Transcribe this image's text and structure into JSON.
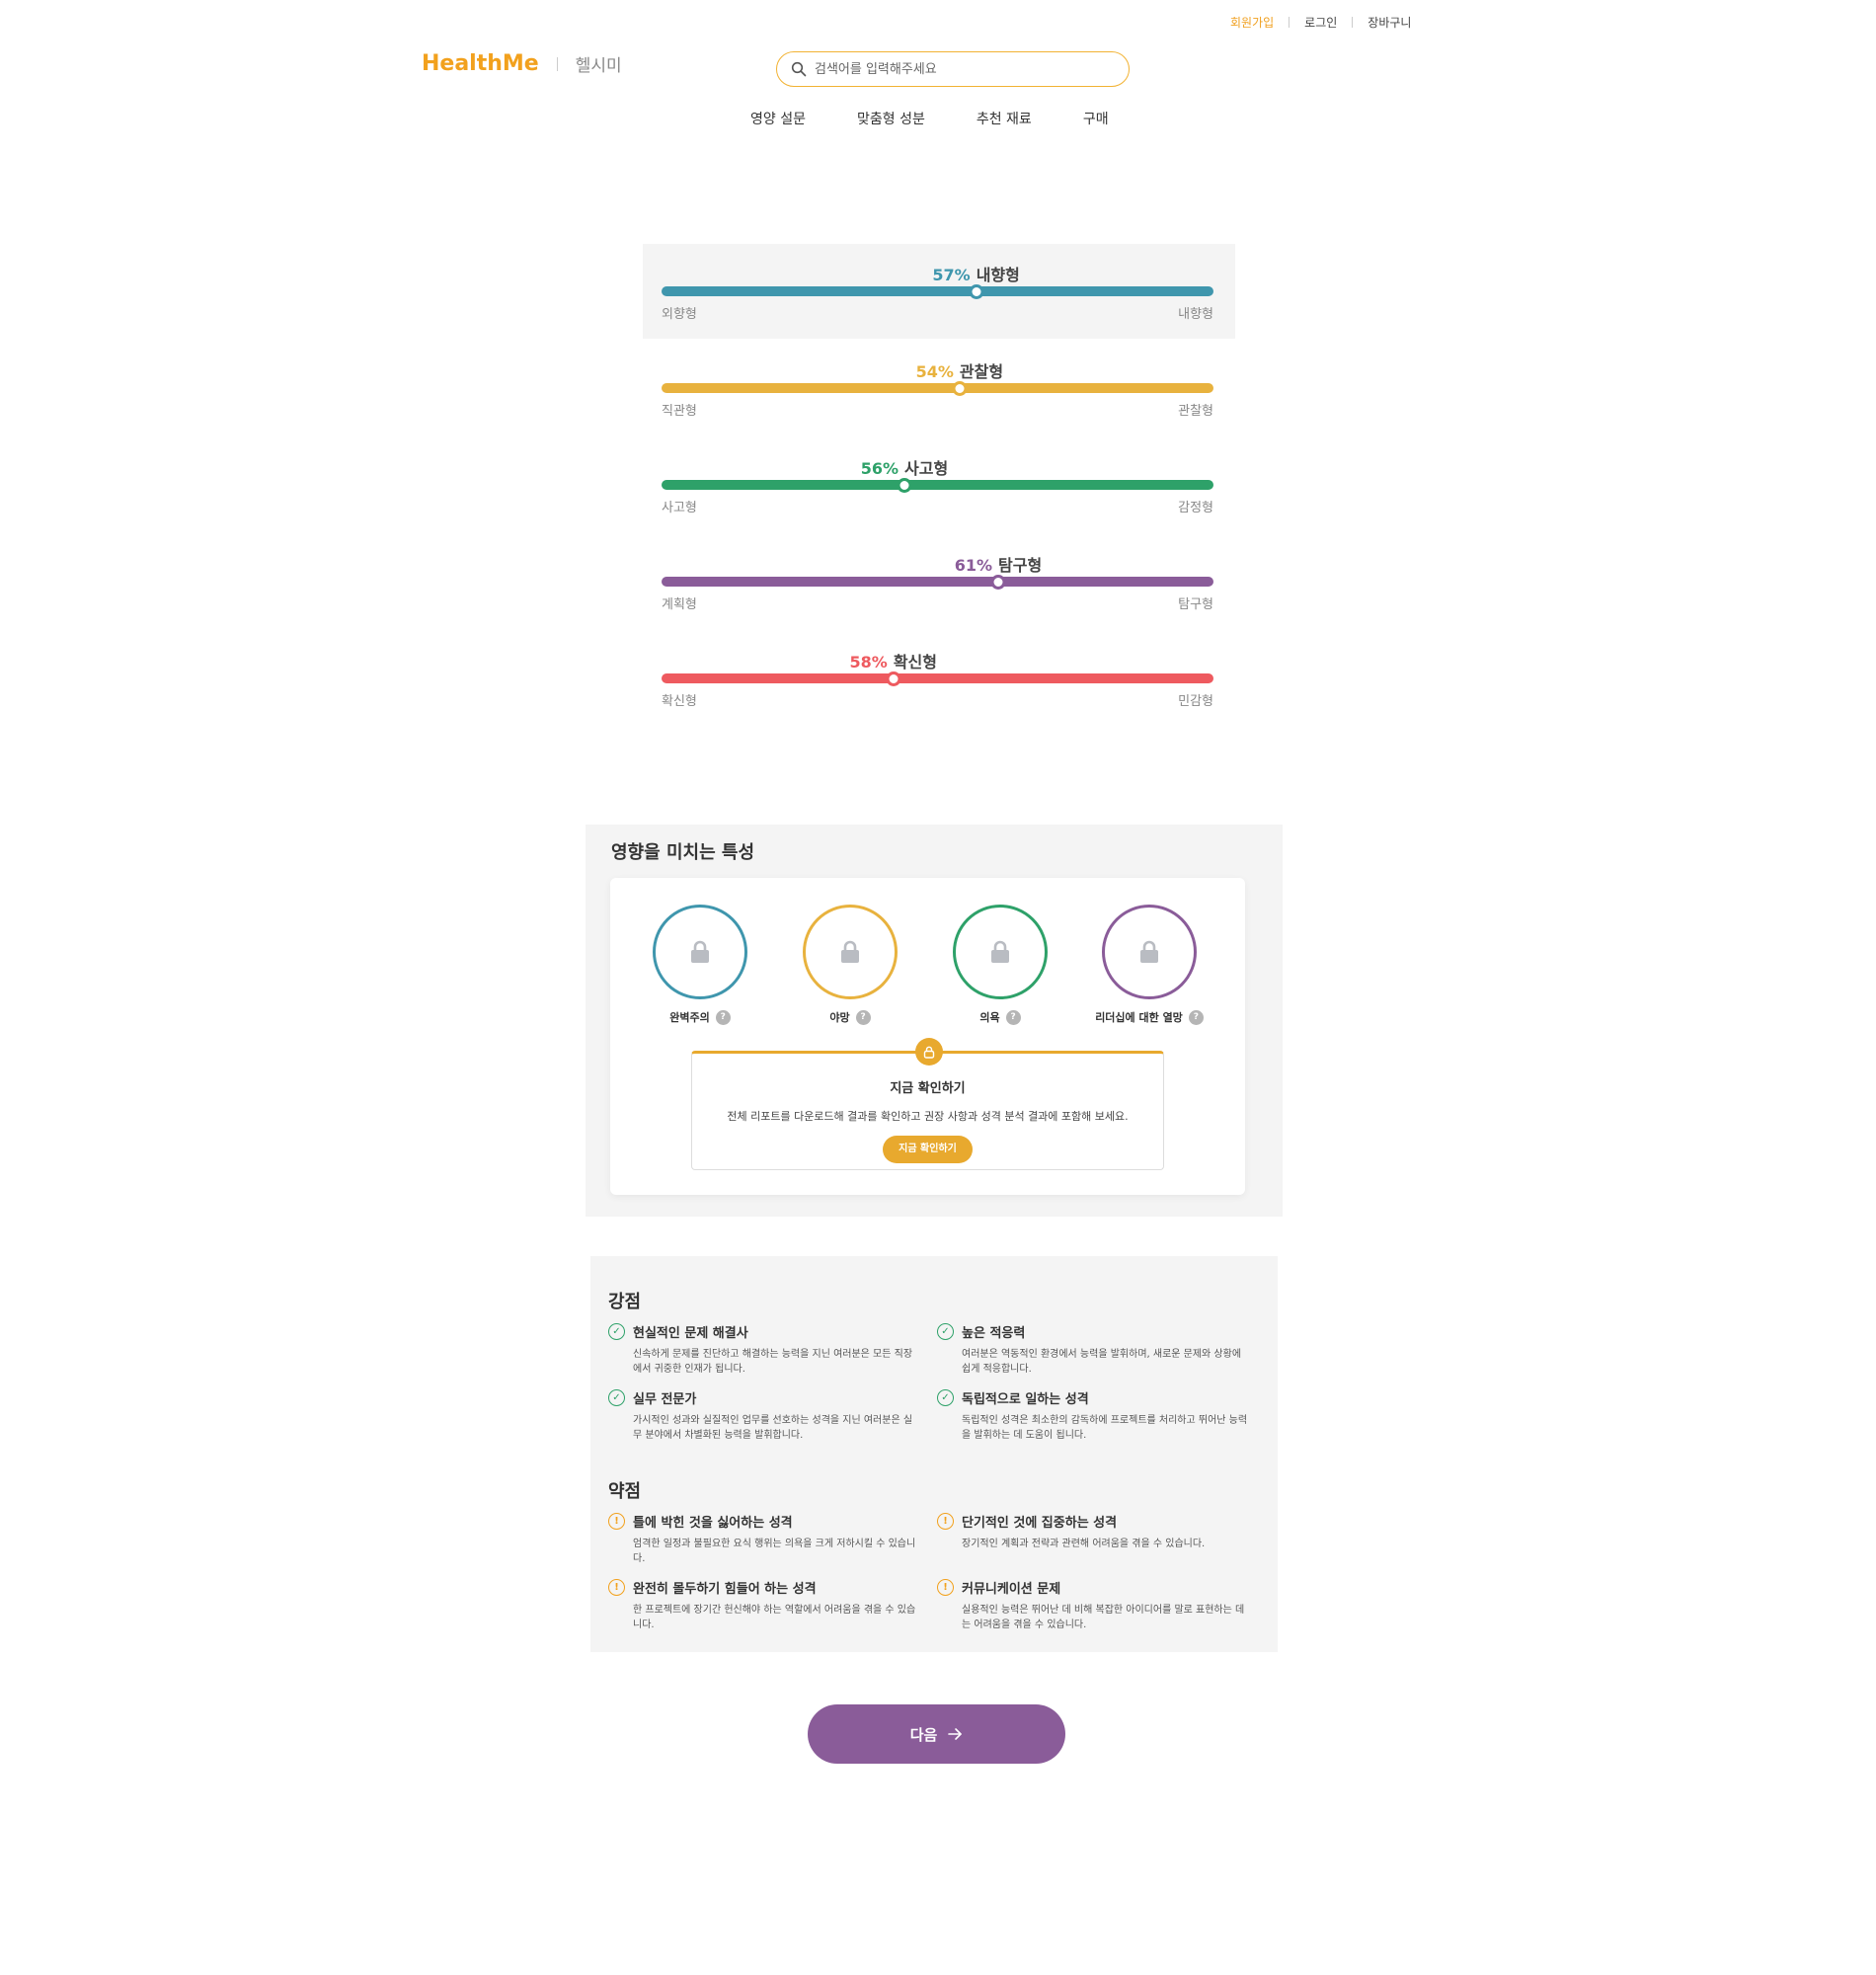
{
  "util": {
    "signup": "회원가입",
    "login": "로그인",
    "cart": "장바구니"
  },
  "header": {
    "brand": "HealthMe",
    "brand_kr": "헬시미",
    "search_placeholder": "검색어를 입력해주세요"
  },
  "nav": [
    "영양 설문",
    "맞춤형 성분",
    "추천 재료",
    "구매"
  ],
  "colors": {
    "accent": "#f2a11d",
    "blue": "#3f96ad",
    "yellow": "#e8b23e",
    "green": "#2ea169",
    "purple": "#8a5c99",
    "red": "#ee5a5f"
  },
  "traits": [
    {
      "pct": "57%",
      "name": "내향형",
      "value": 57,
      "left_label": "외향형",
      "right_label": "내향형",
      "color": "#3f96ad"
    },
    {
      "pct": "54%",
      "name": "관찰형",
      "value": 54,
      "left_label": "직관형",
      "right_label": "관찰형",
      "color": "#e8b23e"
    },
    {
      "pct": "56%",
      "name": "사고형",
      "value": 44,
      "left_label": "사고형",
      "right_label": "감정형",
      "color": "#2ea169"
    },
    {
      "pct": "61%",
      "name": "탐구형",
      "value": 61,
      "left_label": "계획형",
      "right_label": "탐구형",
      "color": "#8a5c99"
    },
    {
      "pct": "58%",
      "name": "확신형",
      "value": 42,
      "left_label": "확신형",
      "right_label": "민감형",
      "color": "#ee5a5f"
    }
  ],
  "influencing": {
    "title": "영향을 미치는 특성",
    "items": [
      {
        "label": "완벽주의",
        "color": "#3f96ad",
        "icon": "lock-icon"
      },
      {
        "label": "야망",
        "color": "#e8b23e",
        "icon": "lock-icon"
      },
      {
        "label": "의욕",
        "color": "#2ea169",
        "icon": "lock-icon"
      },
      {
        "label": "리더십에 대한 열망",
        "color": "#8a5c99",
        "icon": "lock-icon"
      }
    ],
    "help": "?",
    "unlock": {
      "title": "지금 확인하기",
      "desc": "전체 리포트를 다운로드해 결과를 확인하고 권장 사항과 성격 분석 결과에 포함해 보세요.",
      "button": "지금 확인하기"
    }
  },
  "strengths": {
    "title": "강점",
    "items": [
      {
        "title": "현실적인 문제 해결사",
        "desc": "신속하게 문제를 진단하고 해결하는 능력을 지닌 여러분은 모든 직장에서 귀중한 인재가 됩니다."
      },
      {
        "title": "높은 적응력",
        "desc": "여러분은 역동적인 환경에서 능력을 발휘하며, 새로운 문제와 상황에 쉽게 적응합니다."
      },
      {
        "title": "실무 전문가",
        "desc": "가시적인 성과와 실질적인 업무를 선호하는 성격을 지닌 여러분은 실무 분야에서 차별화된 능력을 발휘합니다."
      },
      {
        "title": "독립적으로 일하는 성격",
        "desc": "독립적인 성격은 최소한의 감독하에 프로젝트를 처리하고 뛰어난 능력을 발휘하는 데 도움이 됩니다."
      }
    ]
  },
  "weaknesses": {
    "title": "약점",
    "items": [
      {
        "title": "틀에 박힌 것을 싫어하는 성격",
        "desc": "엄격한 일정과 불필요한 요식 행위는 의욕을 크게 저하시킬 수 있습니다."
      },
      {
        "title": "단기적인 것에 집중하는 성격",
        "desc": "장기적인 계획과 전략과 관련해 어려움을 겪을 수 있습니다."
      },
      {
        "title": "완전히 몰두하기 힘들어 하는 성격",
        "desc": "한 프로젝트에 장기간 헌신해야 하는 역할에서 어려움을 겪을 수 있습니다."
      },
      {
        "title": "커뮤니케이션 문제",
        "desc": "실용적인 능력은 뛰어난 데 비해 복잡한 아이디어를 말로 표현하는 데는 어려움을 겪을 수 있습니다."
      }
    ]
  },
  "next_button": "다음"
}
